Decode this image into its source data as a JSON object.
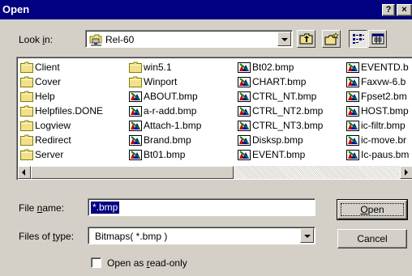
{
  "window": {
    "title": "Open",
    "help_label": "?",
    "close_label": "×"
  },
  "look_in": {
    "label_pre": "Look ",
    "label_mnemonic": "i",
    "label_post": "n:",
    "value": "Rel-60"
  },
  "toolbar": {
    "up_icon": "up-one-level-icon",
    "new_folder_icon": "create-new-folder-icon",
    "list_icon": "list-view-icon",
    "details_icon": "details-view-icon"
  },
  "files": [
    {
      "name": "Client",
      "type": "folder"
    },
    {
      "name": "Cover",
      "type": "folder"
    },
    {
      "name": "Help",
      "type": "folder"
    },
    {
      "name": "Helpfiles.DONE",
      "type": "folder"
    },
    {
      "name": "Logview",
      "type": "folder"
    },
    {
      "name": "Redirect",
      "type": "folder"
    },
    {
      "name": "Server",
      "type": "folder"
    },
    {
      "name": "win5.1",
      "type": "folder"
    },
    {
      "name": "Winport",
      "type": "folder"
    },
    {
      "name": "ABOUT.bmp",
      "type": "bmp"
    },
    {
      "name": "a-r-add.bmp",
      "type": "bmp"
    },
    {
      "name": "Attach-1.bmp",
      "type": "bmp"
    },
    {
      "name": "Brand.bmp",
      "type": "bmp"
    },
    {
      "name": "Bt01.bmp",
      "type": "bmp"
    },
    {
      "name": "Bt02.bmp",
      "type": "bmp"
    },
    {
      "name": "CHART.bmp",
      "type": "bmp"
    },
    {
      "name": "CTRL_NT.bmp",
      "type": "bmp"
    },
    {
      "name": "CTRL_NT2.bmp",
      "type": "bmp"
    },
    {
      "name": "CTRL_NT3.bmp",
      "type": "bmp"
    },
    {
      "name": "Disksp.bmp",
      "type": "bmp"
    },
    {
      "name": "EVENT.bmp",
      "type": "bmp"
    },
    {
      "name": "EVENTD.b",
      "type": "bmp"
    },
    {
      "name": "Faxvw-6.b",
      "type": "bmp"
    },
    {
      "name": "Fpset2.bm",
      "type": "bmp"
    },
    {
      "name": "HOST.bmp",
      "type": "bmp"
    },
    {
      "name": "ic-filtr.bmp",
      "type": "bmp"
    },
    {
      "name": "ic-move.br",
      "type": "bmp"
    },
    {
      "name": "Ic-paus.bm",
      "type": "bmp"
    }
  ],
  "file_name": {
    "label_pre": "File ",
    "label_mnemonic": "n",
    "label_post": "ame:",
    "value": "*.bmp"
  },
  "file_type": {
    "label_pre": "Files of ",
    "label_mnemonic": "t",
    "label_post": "ype:",
    "value": "Bitmaps( *.bmp )"
  },
  "buttons": {
    "open_mnemonic": "O",
    "open_rest": "pen",
    "cancel": "Cancel"
  },
  "read_only": {
    "label_pre": "Open as ",
    "label_mnemonic": "r",
    "label_post": "ead-only",
    "checked": false
  },
  "colors": {
    "titlebar": "#000080",
    "face": "#d4d0c8",
    "selection": "#000080"
  }
}
